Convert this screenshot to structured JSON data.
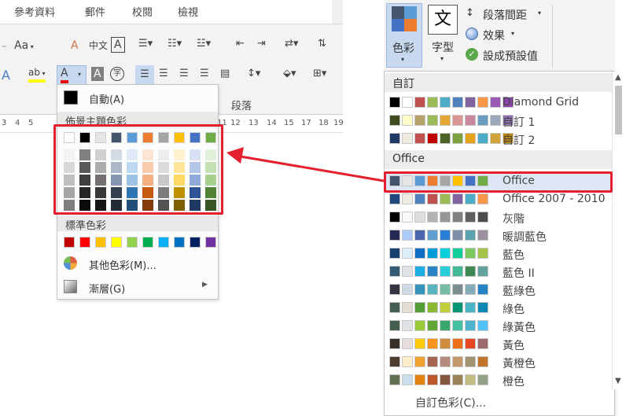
{
  "left_ribbon": {
    "tabs": [
      "參考資料",
      "郵件",
      "校閱",
      "檢視"
    ],
    "group_label": "段落",
    "ruler_numbers": [
      "3",
      "4",
      "5",
      "6",
      "7",
      "8",
      "9",
      "10",
      "11",
      "12",
      "13",
      "14",
      "15",
      "16",
      "17",
      "18",
      "19"
    ],
    "tools": {
      "font_size": "Aa",
      "clear": "A",
      "phonetic": "中文",
      "border_char": "A",
      "text_effect": "A",
      "highlight": "ab",
      "font_color": "A",
      "char_shading": "A",
      "enclose": "字"
    }
  },
  "color_menu": {
    "automatic_label": "自動(A)",
    "theme_colors_label": "佈景主題色彩",
    "theme_colors": [
      "#FFFFFF",
      "#000000",
      "#E7E6E6",
      "#44546A",
      "#5B9BD5",
      "#ED7D31",
      "#A5A5A5",
      "#FFC000",
      "#4472C4",
      "#70AD47"
    ],
    "theme_shades": [
      [
        "#F2F2F2",
        "#808080",
        "#D0CECE",
        "#D6DCE4",
        "#DEEBF6",
        "#FBE5D5",
        "#EDEDED",
        "#FFF2CC",
        "#D9E2F3",
        "#E2EFD9"
      ],
      [
        "#D8D8D8",
        "#595959",
        "#AEABAB",
        "#ADB9CA",
        "#BDD7EE",
        "#F7CBAC",
        "#DBDBDB",
        "#FEE599",
        "#B4C6E7",
        "#C5E0B3"
      ],
      [
        "#BFBFBF",
        "#3F3F3F",
        "#757070",
        "#8496B0",
        "#9CC3E5",
        "#F4B083",
        "#C9C9C9",
        "#FFD965",
        "#8EAADB",
        "#A8D08D"
      ],
      [
        "#A5A5A5",
        "#262626",
        "#3A3838",
        "#323F4F",
        "#2E75B5",
        "#C55A11",
        "#7B7B7B",
        "#BF9000",
        "#2F5496",
        "#538135"
      ],
      [
        "#7F7F7F",
        "#0C0C0C",
        "#171616",
        "#222A35",
        "#1F4E79",
        "#833C0B",
        "#525252",
        "#7F6000",
        "#1F3864",
        "#375623"
      ]
    ],
    "standard_colors_label": "標準色彩",
    "standard_colors": [
      "#C00000",
      "#FF0000",
      "#FFC000",
      "#FFFF00",
      "#92D050",
      "#00B050",
      "#00B0F0",
      "#0070C0",
      "#002060",
      "#7030A0"
    ],
    "more_colors_label": "其他色彩(M)...",
    "gradient_label": "漸層(G)"
  },
  "right_ribbon": {
    "colors_label": "色彩",
    "fonts_label": "字型",
    "fonts_glyph": "文",
    "paragraph_spacing_label": "段落間距",
    "effects_label": "效果",
    "set_default_label": "設成預設值"
  },
  "theme_list": {
    "custom_header": "自訂",
    "custom_themes": [
      {
        "name": "Diamond Grid",
        "colors": [
          "#000000",
          "#FFFFFF",
          "#C0504D",
          "#9BBB59",
          "#4BACC6",
          "#4F81BD",
          "#8064A2",
          "#F79646",
          "#9B59B6",
          "#8E44AD"
        ]
      },
      {
        "name": "自訂 1",
        "colors": [
          "#3D4A1E",
          "#FFFFCC",
          "#B5A36B",
          "#9BBB59",
          "#E5A533",
          "#D99694",
          "#C888A0",
          "#6A9BC0",
          "#9BA8B8",
          "#8E6FB0"
        ]
      },
      {
        "name": "自訂 2",
        "colors": [
          "#1F3864",
          "#EEECE1",
          "#C0504D",
          "#C00000",
          "#4F6228",
          "#7BA03D",
          "#E3A21A",
          "#4BACC6",
          "#D1A33C",
          "#B8860B"
        ]
      }
    ],
    "office_header": "Office",
    "office_themes": [
      {
        "name": "Office",
        "colors": [
          "#44546A",
          "#E7E6E6",
          "#5B9BD5",
          "#ED7D31",
          "#A5A5A5",
          "#FFC000",
          "#4472C4",
          "#70AD47"
        ]
      },
      {
        "name": "Office 2007 - 2010",
        "colors": [
          "#1F497D",
          "#EEECE1",
          "#4F81BD",
          "#C0504D",
          "#9BBB59",
          "#8064A2",
          "#4BACC6",
          "#F79646"
        ]
      },
      {
        "name": "灰階",
        "colors": [
          "#000000",
          "#F8F8F8",
          "#DDDDDD",
          "#B2B2B2",
          "#969696",
          "#808080",
          "#5F5F5F",
          "#4D4D4D"
        ]
      },
      {
        "name": "暖調藍色",
        "colors": [
          "#242852",
          "#ACCBF9",
          "#4A66AC",
          "#629DD1",
          "#297FD5",
          "#7F8FA9",
          "#5AA2AE",
          "#9D90A0"
        ]
      },
      {
        "name": "藍色",
        "colors": [
          "#17406D",
          "#DBEFF9",
          "#0F6FC6",
          "#009DD9",
          "#0BD0D9",
          "#10CF9B",
          "#7CCA62",
          "#A5C249"
        ]
      },
      {
        "name": "藍色 II",
        "colors": [
          "#335B74",
          "#DFE3E5",
          "#1CADE4",
          "#2683C6",
          "#27CED7",
          "#42BA97",
          "#3E8853",
          "#62A39F"
        ]
      },
      {
        "name": "藍綠色",
        "colors": [
          "#373545",
          "#CEDBE6",
          "#3494BA",
          "#58B6C0",
          "#75BDA7",
          "#7A8C8E",
          "#84ACB6",
          "#2683C6"
        ]
      },
      {
        "name": "綠色",
        "colors": [
          "#455F51",
          "#E3DED1",
          "#549E39",
          "#8AB833",
          "#C0CF3A",
          "#029676",
          "#4AB5C4",
          "#0989B1"
        ]
      },
      {
        "name": "綠黃色",
        "colors": [
          "#455F51",
          "#DFE3E5",
          "#99CB38",
          "#63A537",
          "#37A76F",
          "#44C1A3",
          "#4EB3CF",
          "#51C3F9"
        ]
      },
      {
        "name": "黃色",
        "colors": [
          "#39302A",
          "#E5DEDB",
          "#FFCA08",
          "#F8931D",
          "#CE8D3E",
          "#EC7016",
          "#E64823",
          "#9C6A6A"
        ]
      },
      {
        "name": "黃橙色",
        "colors": [
          "#4E3B30",
          "#FBEEC9",
          "#F0A22E",
          "#A5644E",
          "#B58B80",
          "#C3986D",
          "#A19574",
          "#C17529"
        ]
      },
      {
        "name": "橙色",
        "colors": [
          "#637052",
          "#CCDDEA",
          "#E48312",
          "#BD582C",
          "#865640",
          "#9B8357",
          "#C2BC80",
          "#94A088"
        ]
      }
    ],
    "custom_colors_label": "自訂色彩(C)..."
  },
  "callout": {
    "color": "#E5202E"
  }
}
